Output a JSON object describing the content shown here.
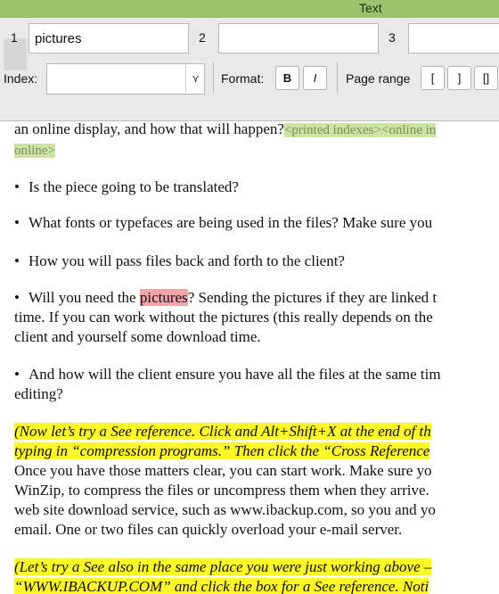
{
  "window": {
    "title": "Text"
  },
  "fields": [
    {
      "num": "1",
      "value": "pictures"
    },
    {
      "num": "2",
      "value": ""
    },
    {
      "num": "3",
      "value": ""
    }
  ],
  "toolbar": {
    "index_label": "Index:",
    "index_value": "",
    "format_label": "Format:",
    "bold_label": "B",
    "italic_label": "I",
    "range_label": "Page range",
    "range_open": "[",
    "range_close": "]",
    "range_both": "[]",
    "filter_icon": "funnel-icon"
  },
  "document": {
    "line1a": "an online display, and how that will happen?",
    "line1b": "<printed indexes><online in",
    "line2": "online>",
    "bullet1": "Is the piece going to be translated?",
    "bullet2": "What fonts or typefaces are being used in the files? Make sure you",
    "bullet3": "How you will pass files back and forth to the client?",
    "bullet4a": "Will you need the ",
    "bullet4_hit": "pictures",
    "bullet4b": "? Sending the pictures if they are linked t",
    "bullet4_l2": "time. If you can work without the pictures (this really depends on the",
    "bullet4_l3": "client and yourself some download time.",
    "bullet5": "And how will the client ensure you have all the files at the same tim",
    "bullet5_l2": "editing?",
    "yellow1": "(Now let’s try a See reference. Click and Alt+Shift+X at the end of th",
    "yellow2": "typing in “compression programs.” Then click the “Cross Reference",
    "para1": "Once you have those matters clear, you can start work. Make sure yo",
    "para2": "WinZip, to compress the files or uncompress them when they arrive.",
    "para3": "web site download service, such as www.ibackup.com, so you and yo",
    "para4": "email. One or two files can quickly overload your e-mail server.",
    "yellow3": "(Let’s try a See also in the same place you were just working above –",
    "yellow4": "“WWW.IBACKUP.COM” and click the box for a See reference. Noti"
  }
}
